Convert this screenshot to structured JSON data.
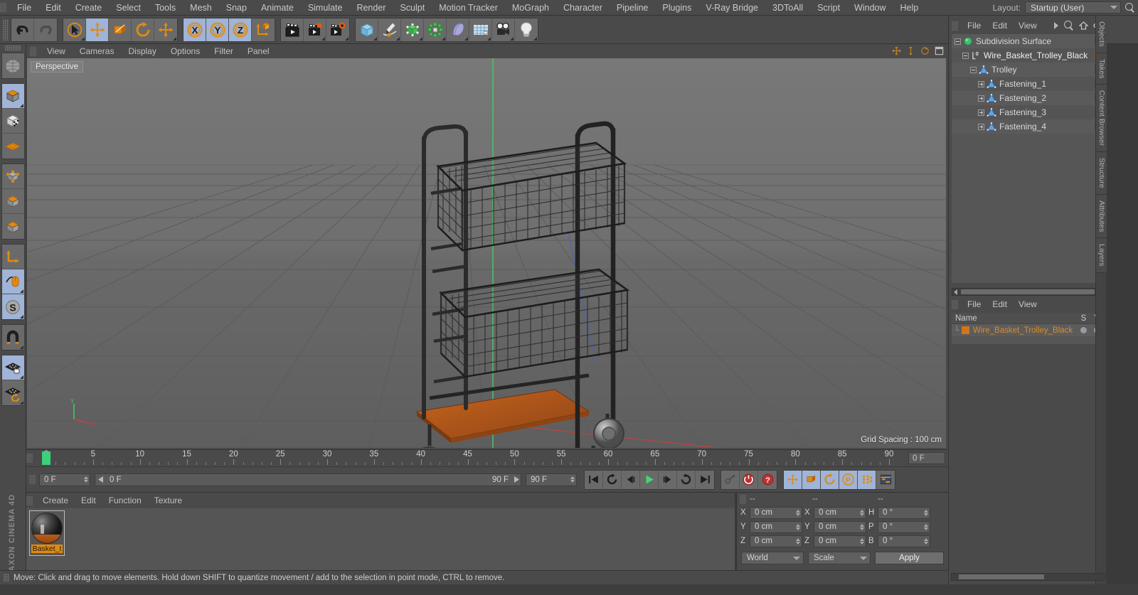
{
  "app": {
    "title": "CINEMA 4D",
    "vendor": "MAXON"
  },
  "menu": {
    "items": [
      "File",
      "Edit",
      "Create",
      "Select",
      "Tools",
      "Mesh",
      "Snap",
      "Animate",
      "Simulate",
      "Render",
      "Sculpt",
      "Motion Tracker",
      "MoGraph",
      "Character",
      "Pipeline",
      "Plugins",
      "V-Ray Bridge",
      "3DToAll",
      "Script",
      "Window",
      "Help"
    ]
  },
  "layout": {
    "label": "Layout:",
    "value": "Startup (User)",
    "search_icon": "search-icon"
  },
  "toolbar": {
    "groups": [
      {
        "name": "history",
        "buttons": [
          {
            "icon": "undo-icon",
            "label": "Undo",
            "active": false,
            "corner": false
          },
          {
            "icon": "redo-icon",
            "label": "Redo",
            "active": false,
            "corner": false
          }
        ]
      },
      {
        "name": "transform-tools",
        "buttons": [
          {
            "icon": "live-selection-icon",
            "label": "Live Selection",
            "active": false,
            "corner": true
          },
          {
            "icon": "move-icon",
            "label": "Move",
            "active": true,
            "corner": false
          },
          {
            "icon": "scale-icon",
            "label": "Scale",
            "active": false,
            "corner": false
          },
          {
            "icon": "rotate-icon",
            "label": "Rotate",
            "active": false,
            "corner": false
          },
          {
            "icon": "move-alt-icon",
            "label": "Move Alt",
            "active": false,
            "corner": true
          }
        ]
      },
      {
        "name": "axis-locks",
        "buttons": [
          {
            "icon": "x-axis-icon",
            "label": "X",
            "active": true,
            "corner": false
          },
          {
            "icon": "y-axis-icon",
            "label": "Y",
            "active": true,
            "corner": false
          },
          {
            "icon": "z-axis-icon",
            "label": "Z",
            "active": true,
            "corner": false
          },
          {
            "icon": "world-coordinates-icon",
            "label": "World/Object",
            "active": false,
            "corner": false
          }
        ]
      },
      {
        "name": "render-group",
        "buttons": [
          {
            "icon": "render-view-icon",
            "label": "Render View",
            "active": false,
            "corner": false
          },
          {
            "icon": "render-region-icon",
            "label": "Render to Picture Viewer",
            "active": false,
            "corner": true
          },
          {
            "icon": "render-settings-icon",
            "label": "Render Settings",
            "active": false,
            "corner": true
          }
        ]
      },
      {
        "name": "objects-group",
        "buttons": [
          {
            "icon": "cube-primitive-icon",
            "label": "Add Cube Object",
            "active": false,
            "corner": true
          },
          {
            "icon": "spline-pen-icon",
            "label": "Add Spline Object",
            "active": false,
            "corner": true
          },
          {
            "icon": "generator-icon",
            "label": "Add Generator Object",
            "active": false,
            "corner": true
          },
          {
            "icon": "mograph-icon",
            "label": "Add MoGraph Object",
            "active": false,
            "corner": true
          },
          {
            "icon": "deformer-icon",
            "label": "Add Deformer Object",
            "active": false,
            "corner": true
          },
          {
            "icon": "scene-floor-icon",
            "label": "Add Scene Object",
            "active": false,
            "corner": true
          },
          {
            "icon": "camera-icon",
            "label": "Add Camera Object",
            "active": false,
            "corner": true
          },
          {
            "icon": "light-icon",
            "label": "Add Light Object",
            "active": false,
            "corner": true
          }
        ]
      }
    ]
  },
  "left_toolbar": {
    "buttons": [
      {
        "icon": "texture-axis-icon",
        "label": "Make Editable / Texture",
        "active": false
      },
      {
        "icon": "model-mode-icon",
        "label": "Model Mode",
        "active": true
      },
      {
        "icon": "texture-mode-icon",
        "label": "Texture Mode",
        "active": false
      },
      {
        "icon": "workplane-icon",
        "label": "Workplane Mode",
        "active": false
      },
      {
        "icon": "points-mode-icon",
        "label": "Points Mode",
        "active": false
      },
      {
        "icon": "edges-mode-icon",
        "label": "Edges Mode",
        "active": false
      },
      {
        "icon": "polygons-mode-icon",
        "label": "Polygons Mode",
        "active": false
      },
      {
        "icon": "axis-mode-icon",
        "label": "Enable Axis Modification",
        "active": false
      },
      {
        "icon": "viewport-solo-icon",
        "label": "Viewport Solo Mode",
        "active": true
      },
      {
        "icon": "snap-icon",
        "label": "Enable Snapping",
        "active": true
      },
      {
        "icon": "magnet-icon",
        "label": "Magnet Tool",
        "active": false
      },
      {
        "icon": "lock-workplane-icon",
        "label": "Lock Workplane",
        "active": true
      },
      {
        "icon": "planar-workplane-icon",
        "label": "Planar Workplane",
        "active": false
      }
    ]
  },
  "viewport": {
    "menu": [
      "View",
      "Cameras",
      "Display",
      "Options",
      "Filter",
      "Panel"
    ],
    "label": "Perspective",
    "grid_spacing": "Grid Spacing : 100 cm",
    "axis_labels": {
      "y": "Y",
      "x": "X"
    },
    "corner_icons": [
      "pan-view-icon",
      "zoom-view-icon",
      "rotate-view-icon",
      "maximize-view-icon"
    ]
  },
  "timeline": {
    "ticks": [
      0,
      5,
      10,
      15,
      20,
      25,
      30,
      35,
      40,
      45,
      50,
      55,
      60,
      65,
      70,
      75,
      80,
      85,
      90
    ],
    "playhead_frame": 0,
    "end_field": "0 F"
  },
  "transport": {
    "current_frame": "0 F",
    "range_start": "0 F",
    "range_end": "90 F",
    "preview_end": "90 F",
    "buttons": [
      {
        "icon": "go-to-start-icon",
        "label": "Go to Start",
        "active": false
      },
      {
        "icon": "play-backwards-loop-icon",
        "label": "Play Backwards",
        "active": false
      },
      {
        "icon": "step-back-icon",
        "label": "Go to Previous Frame",
        "active": false
      },
      {
        "icon": "play-icon",
        "label": "Play Forwards",
        "active": false
      },
      {
        "icon": "step-forward-icon",
        "label": "Go to Next Frame",
        "active": false
      },
      {
        "icon": "loop-icon",
        "label": "Play Forwards Loop",
        "active": false
      },
      {
        "icon": "go-to-end-icon",
        "label": "Go to End",
        "active": false
      }
    ],
    "key_buttons": [
      {
        "icon": "autokey-off-icon",
        "label": "Autokeying",
        "active": false
      },
      {
        "icon": "record-icon",
        "label": "Record Active Objects",
        "active": false
      },
      {
        "icon": "key-selection-icon",
        "label": "Keyframe Selection",
        "active": false
      }
    ],
    "param_buttons": [
      {
        "icon": "record-position-icon",
        "label": "Position",
        "active": true
      },
      {
        "icon": "record-scale-icon",
        "label": "Scale",
        "active": true
      },
      {
        "icon": "record-rotation-icon",
        "label": "Rotation",
        "active": true
      },
      {
        "icon": "record-pla-icon",
        "label": "Parameter (P)",
        "active": true
      },
      {
        "icon": "record-points-icon",
        "label": "Point Level Animation",
        "active": true
      },
      {
        "icon": "timeline-icon",
        "label": "Timeline",
        "active": false
      }
    ]
  },
  "material_manager": {
    "menu": [
      "Create",
      "Edit",
      "Function",
      "Texture"
    ],
    "materials": [
      {
        "name": "Basket_t",
        "selected": true
      }
    ]
  },
  "coordinates": {
    "headers": [
      "--",
      "--",
      "--"
    ],
    "rows": [
      {
        "pos_label": "X",
        "pos_value": "0 cm",
        "size_label": "X",
        "size_value": "0 cm",
        "rot_label": "H",
        "rot_value": "0 °"
      },
      {
        "pos_label": "Y",
        "pos_value": "0 cm",
        "size_label": "Y",
        "size_value": "0 cm",
        "rot_label": "P",
        "rot_value": "0 °"
      },
      {
        "pos_label": "Z",
        "pos_value": "0 cm",
        "size_label": "Z",
        "size_value": "0 cm",
        "rot_label": "B",
        "rot_value": "0 °"
      }
    ],
    "system": "World",
    "mode": "Scale",
    "apply": "Apply"
  },
  "object_manager": {
    "menu": [
      "File",
      "Edit",
      "View"
    ],
    "icons": [
      "more-arrow-icon",
      "search-icon",
      "home-icon",
      "ellipse-icon"
    ],
    "items": [
      {
        "label": "Subdivision Surface",
        "icon": "subdivision-surface-icon",
        "depth": 0,
        "expander": "minus",
        "has_material": false
      },
      {
        "label": "Wire_Basket_Trolley_Black",
        "icon": "layer-zero-icon",
        "depth": 1,
        "expander": "minus",
        "has_material": true,
        "selected": true
      },
      {
        "label": "Trolley",
        "icon": "polygon-object-icon",
        "depth": 2,
        "expander": "minus",
        "has_material": false
      },
      {
        "label": "Fastening_1",
        "icon": "polygon-object-icon",
        "depth": 3,
        "expander": "plus",
        "has_material": false
      },
      {
        "label": "Fastening_2",
        "icon": "polygon-object-icon",
        "depth": 3,
        "expander": "plus",
        "has_material": false
      },
      {
        "label": "Fastening_3",
        "icon": "polygon-object-icon",
        "depth": 3,
        "expander": "plus",
        "has_material": false
      },
      {
        "label": "Fastening_4",
        "icon": "polygon-object-icon",
        "depth": 3,
        "expander": "plus",
        "has_material": false
      }
    ]
  },
  "layer_manager": {
    "menu": [
      "File",
      "Edit",
      "View"
    ],
    "columns": [
      "Name",
      "S",
      "V"
    ],
    "rows": [
      {
        "name": "Wire_Basket_Trolley_Black",
        "color": "#d2741c"
      }
    ]
  },
  "right_tabs": [
    "Objects",
    "Takes",
    "Content Browser",
    "Structure",
    "Attributes",
    "Layers"
  ],
  "status_bar": {
    "message": "Move: Click and drag to move elements. Hold down SHIFT to quantize movement / add to the selection in point mode, CTRL to remove."
  },
  "colors": {
    "accent_orange": "#e08a10",
    "material_tag": "#d2741c",
    "highlight_blue": "#9fb4d6",
    "playhead_green": "#3cd07a",
    "panel_bg": "#4a4a4a"
  }
}
